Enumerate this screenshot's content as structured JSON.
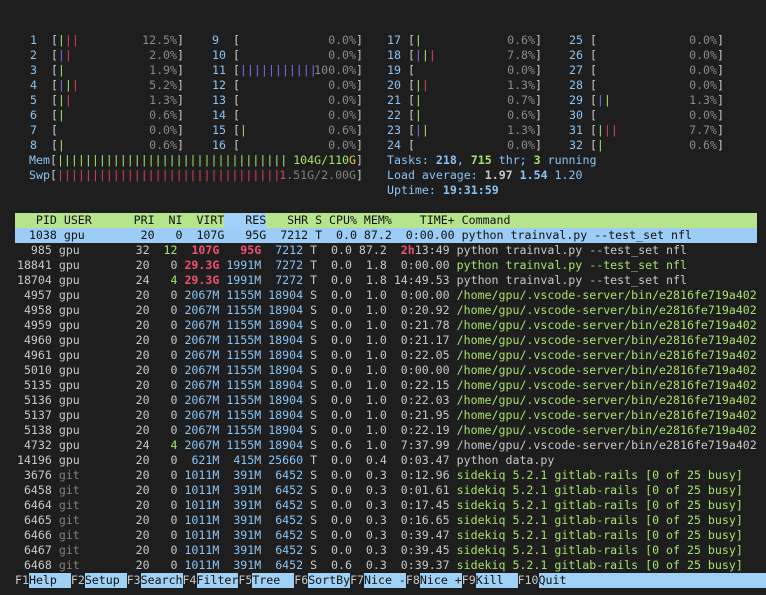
{
  "colors": {
    "label": "#89c4f4",
    "green": "#a6e26b",
    "red": "#d9425f",
    "purple": "#7d6ee6",
    "header_bg": "#b5e48c",
    "selected_bg": "#9ccdf6",
    "background": "#1e1e1e"
  },
  "cpus": [
    {
      "id": "1",
      "bars": [
        "g",
        "r",
        "r"
      ],
      "value": "12.5%"
    },
    {
      "id": "2",
      "bars": [
        "p",
        "r"
      ],
      "value": "2.0%"
    },
    {
      "id": "3",
      "bars": [
        "g"
      ],
      "value": "1.9%"
    },
    {
      "id": "4",
      "bars": [
        "p",
        "g",
        "r"
      ],
      "value": "5.2%"
    },
    {
      "id": "5",
      "bars": [
        "g",
        "r"
      ],
      "value": "1.3%"
    },
    {
      "id": "6",
      "bars": [
        "g"
      ],
      "value": "0.6%"
    },
    {
      "id": "7",
      "bars": [],
      "value": "0.0%"
    },
    {
      "id": "8",
      "bars": [
        "g"
      ],
      "value": "0.6%"
    },
    {
      "id": "9",
      "bars": [],
      "value": "0.0%"
    },
    {
      "id": "10",
      "bars": [],
      "value": "0.0%"
    },
    {
      "id": "11",
      "bars": [
        "p",
        "p",
        "p",
        "p",
        "p",
        "p",
        "p",
        "p",
        "p",
        "p",
        "p"
      ],
      "value": "100.0%",
      "value_color": "pv"
    },
    {
      "id": "12",
      "bars": [],
      "value": "0.0%"
    },
    {
      "id": "13",
      "bars": [],
      "value": "0.0%"
    },
    {
      "id": "14",
      "bars": [],
      "value": "0.0%"
    },
    {
      "id": "15",
      "bars": [
        "g"
      ],
      "value": "0.6%"
    },
    {
      "id": "16",
      "bars": [],
      "value": "0.0%"
    },
    {
      "id": "17",
      "bars": [
        "g"
      ],
      "value": "0.6%"
    },
    {
      "id": "18",
      "bars": [
        "p",
        "g",
        "r"
      ],
      "value": "7.8%"
    },
    {
      "id": "19",
      "bars": [],
      "value": "0.0%"
    },
    {
      "id": "20",
      "bars": [
        "g",
        "r"
      ],
      "value": "1.3%"
    },
    {
      "id": "21",
      "bars": [
        "g"
      ],
      "value": "0.7%"
    },
    {
      "id": "22",
      "bars": [
        "g"
      ],
      "value": "0.6%"
    },
    {
      "id": "23",
      "bars": [
        "p",
        "g"
      ],
      "value": "1.3%"
    },
    {
      "id": "24",
      "bars": [],
      "value": "0.0%"
    },
    {
      "id": "25",
      "bars": [],
      "value": "0.0%"
    },
    {
      "id": "26",
      "bars": [],
      "value": "0.0%"
    },
    {
      "id": "27",
      "bars": [],
      "value": "0.0%"
    },
    {
      "id": "28",
      "bars": [],
      "value": "0.0%"
    },
    {
      "id": "29",
      "bars": [
        "p",
        "g"
      ],
      "value": "1.3%"
    },
    {
      "id": "30",
      "bars": [],
      "value": "0.0%"
    },
    {
      "id": "31",
      "bars": [
        "g",
        "r",
        "r"
      ],
      "value": "7.7%"
    },
    {
      "id": "32",
      "bars": [
        "g"
      ],
      "value": "0.6%"
    }
  ],
  "mem": {
    "label": "Mem",
    "used": "104G/110",
    "unit": "G",
    "fill_fraction": 0.945
  },
  "swp": {
    "label": "Swp",
    "used_first": "1",
    "used_rest": ".51G/2.00G",
    "fill_fraction": 0.755
  },
  "tasks": {
    "label": "Tasks: ",
    "count": "218",
    "sep": ", ",
    "threads": "715",
    "thr_label": " thr; ",
    "running": "3",
    "running_label": " running"
  },
  "load": {
    "label": "Load average: ",
    "l1": "1.97",
    "l5": "1.54",
    "l15": "1.20"
  },
  "uptime": {
    "label": "Uptime: ",
    "value": "19:31:59"
  },
  "columns": {
    "pid": "PID",
    "user": "USER",
    "pri": "PRI",
    "ni": "NI",
    "virt": "VIRT",
    "res": "RES",
    "shr": "SHR",
    "s": "S",
    "cpu": "CPU%",
    "mem": "MEM%",
    "time": "TIME+",
    "cmd": "Command"
  },
  "processes": [
    {
      "pid": "1038",
      "user": "gpu",
      "pri": "20",
      "ni": "0",
      "virt": "107G",
      "res": "95G",
      "shr": "7212",
      "s": "T",
      "cpu": "0.0",
      "mem": "87.2",
      "time": "0:00.00",
      "cmd": "python trainval.py --test_set nfl",
      "selected": true
    },
    {
      "pid": "985",
      "user": "gpu",
      "pri": "32",
      "ni": "12",
      "virt": "107G",
      "res": "95G",
      "shr": "7212",
      "s": "T",
      "cpu": "0.0",
      "mem": "87.2",
      "time_h": "2h",
      "time": "13:49",
      "cmd": "python trainval.py --test_set nfl",
      "hl": {
        "ni": "g",
        "virt": "red",
        "res": "red",
        "shr": "b",
        "cmd": "w"
      }
    },
    {
      "pid": "18841",
      "user": "gpu",
      "pri": "20",
      "ni": "0",
      "virt": "29.3G",
      "res": "1991M",
      "shr": "7272",
      "s": "T",
      "cpu": "0.0",
      "mem": "1.8",
      "time": "0:00.00",
      "cmd": "python trainval.py --test_set nfl",
      "hl": {
        "virt": "red",
        "res": "b",
        "shr": "b",
        "cmd": "g"
      }
    },
    {
      "pid": "18704",
      "user": "gpu",
      "pri": "24",
      "ni": "4",
      "virt": "29.3G",
      "res": "1991M",
      "shr": "7272",
      "s": "T",
      "cpu": "0.0",
      "mem": "1.8",
      "time": "14:49.53",
      "cmd": "python trainval.py --test_set nfl",
      "hl": {
        "ni": "g",
        "virt": "red",
        "res": "b",
        "shr": "b",
        "cmd": "w"
      }
    },
    {
      "pid": "4957",
      "user": "gpu",
      "pri": "20",
      "ni": "0",
      "virt": "2067M",
      "res": "1155M",
      "shr": "18904",
      "s": "S",
      "cpu": "0.0",
      "mem": "1.0",
      "time": "0:00.00",
      "cmd": "/home/gpu/.vscode-server/bin/e2816fe719a402",
      "hl": {
        "virt": "b",
        "res": "b",
        "shr": "b",
        "cmd": "g"
      }
    },
    {
      "pid": "4958",
      "user": "gpu",
      "pri": "20",
      "ni": "0",
      "virt": "2067M",
      "res": "1155M",
      "shr": "18904",
      "s": "S",
      "cpu": "0.0",
      "mem": "1.0",
      "time": "0:20.92",
      "cmd": "/home/gpu/.vscode-server/bin/e2816fe719a402",
      "hl": {
        "virt": "b",
        "res": "b",
        "shr": "b",
        "cmd": "g"
      }
    },
    {
      "pid": "4959",
      "user": "gpu",
      "pri": "20",
      "ni": "0",
      "virt": "2067M",
      "res": "1155M",
      "shr": "18904",
      "s": "S",
      "cpu": "0.0",
      "mem": "1.0",
      "time": "0:21.78",
      "cmd": "/home/gpu/.vscode-server/bin/e2816fe719a402",
      "hl": {
        "virt": "b",
        "res": "b",
        "shr": "b",
        "cmd": "g"
      }
    },
    {
      "pid": "4960",
      "user": "gpu",
      "pri": "20",
      "ni": "0",
      "virt": "2067M",
      "res": "1155M",
      "shr": "18904",
      "s": "S",
      "cpu": "0.0",
      "mem": "1.0",
      "time": "0:21.17",
      "cmd": "/home/gpu/.vscode-server/bin/e2816fe719a402",
      "hl": {
        "virt": "b",
        "res": "b",
        "shr": "b",
        "cmd": "g"
      }
    },
    {
      "pid": "4961",
      "user": "gpu",
      "pri": "20",
      "ni": "0",
      "virt": "2067M",
      "res": "1155M",
      "shr": "18904",
      "s": "S",
      "cpu": "0.0",
      "mem": "1.0",
      "time": "0:22.05",
      "cmd": "/home/gpu/.vscode-server/bin/e2816fe719a402",
      "hl": {
        "virt": "b",
        "res": "b",
        "shr": "b",
        "cmd": "g"
      }
    },
    {
      "pid": "5010",
      "user": "gpu",
      "pri": "20",
      "ni": "0",
      "virt": "2067M",
      "res": "1155M",
      "shr": "18904",
      "s": "S",
      "cpu": "0.0",
      "mem": "1.0",
      "time": "0:00.00",
      "cmd": "/home/gpu/.vscode-server/bin/e2816fe719a402",
      "hl": {
        "virt": "b",
        "res": "b",
        "shr": "b",
        "cmd": "g"
      }
    },
    {
      "pid": "5135",
      "user": "gpu",
      "pri": "20",
      "ni": "0",
      "virt": "2067M",
      "res": "1155M",
      "shr": "18904",
      "s": "S",
      "cpu": "0.0",
      "mem": "1.0",
      "time": "0:22.15",
      "cmd": "/home/gpu/.vscode-server/bin/e2816fe719a402",
      "hl": {
        "virt": "b",
        "res": "b",
        "shr": "b",
        "cmd": "g"
      }
    },
    {
      "pid": "5136",
      "user": "gpu",
      "pri": "20",
      "ni": "0",
      "virt": "2067M",
      "res": "1155M",
      "shr": "18904",
      "s": "S",
      "cpu": "0.0",
      "mem": "1.0",
      "time": "0:22.03",
      "cmd": "/home/gpu/.vscode-server/bin/e2816fe719a402",
      "hl": {
        "virt": "b",
        "res": "b",
        "shr": "b",
        "cmd": "g"
      }
    },
    {
      "pid": "5137",
      "user": "gpu",
      "pri": "20",
      "ni": "0",
      "virt": "2067M",
      "res": "1155M",
      "shr": "18904",
      "s": "S",
      "cpu": "0.0",
      "mem": "1.0",
      "time": "0:21.95",
      "cmd": "/home/gpu/.vscode-server/bin/e2816fe719a402",
      "hl": {
        "virt": "b",
        "res": "b",
        "shr": "b",
        "cmd": "g"
      }
    },
    {
      "pid": "5138",
      "user": "gpu",
      "pri": "20",
      "ni": "0",
      "virt": "2067M",
      "res": "1155M",
      "shr": "18904",
      "s": "S",
      "cpu": "0.0",
      "mem": "1.0",
      "time": "0:22.19",
      "cmd": "/home/gpu/.vscode-server/bin/e2816fe719a402",
      "hl": {
        "virt": "b",
        "res": "b",
        "shr": "b",
        "cmd": "g"
      }
    },
    {
      "pid": "4732",
      "user": "gpu",
      "pri": "24",
      "ni": "4",
      "virt": "2067M",
      "res": "1155M",
      "shr": "18904",
      "s": "S",
      "cpu": "0.6",
      "mem": "1.0",
      "time": "7:37.99",
      "cmd": "/home/gpu/.vscode-server/bin/e2816fe719a402",
      "hl": {
        "ni": "g",
        "virt": "b",
        "res": "b",
        "shr": "b",
        "cmd": "w"
      }
    },
    {
      "pid": "14196",
      "user": "gpu",
      "pri": "20",
      "ni": "0",
      "virt": "621M",
      "res": "415M",
      "shr": "25660",
      "s": "T",
      "cpu": "0.0",
      "mem": "0.4",
      "time": "0:03.47",
      "cmd": "python data.py",
      "hl": {
        "virt": "b",
        "res": "b",
        "shr": "b",
        "cmd": "w"
      }
    },
    {
      "pid": "3676",
      "user": "git",
      "pri": "20",
      "ni": "0",
      "virt": "1011M",
      "res": "391M",
      "shr": "6452",
      "s": "S",
      "cpu": "0.0",
      "mem": "0.3",
      "time": "0:12.96",
      "cmd": "sidekiq 5.2.1 gitlab-rails [0 of 25 busy]",
      "hl": {
        "user": "dim",
        "virt": "b",
        "res": "b",
        "shr": "b",
        "cmd": "g"
      }
    },
    {
      "pid": "6458",
      "user": "git",
      "pri": "20",
      "ni": "0",
      "virt": "1011M",
      "res": "391M",
      "shr": "6452",
      "s": "S",
      "cpu": "0.0",
      "mem": "0.3",
      "time": "0:01.61",
      "cmd": "sidekiq 5.2.1 gitlab-rails [0 of 25 busy]",
      "hl": {
        "user": "dim",
        "virt": "b",
        "res": "b",
        "shr": "b",
        "cmd": "g"
      }
    },
    {
      "pid": "6464",
      "user": "git",
      "pri": "20",
      "ni": "0",
      "virt": "1011M",
      "res": "391M",
      "shr": "6452",
      "s": "S",
      "cpu": "0.0",
      "mem": "0.3",
      "time": "0:17.45",
      "cmd": "sidekiq 5.2.1 gitlab-rails [0 of 25 busy]",
      "hl": {
        "user": "dim",
        "virt": "b",
        "res": "b",
        "shr": "b",
        "cmd": "g"
      }
    },
    {
      "pid": "6465",
      "user": "git",
      "pri": "20",
      "ni": "0",
      "virt": "1011M",
      "res": "391M",
      "shr": "6452",
      "s": "S",
      "cpu": "0.0",
      "mem": "0.3",
      "time": "0:16.65",
      "cmd": "sidekiq 5.2.1 gitlab-rails [0 of 25 busy]",
      "hl": {
        "user": "dim",
        "virt": "b",
        "res": "b",
        "shr": "b",
        "cmd": "g"
      }
    },
    {
      "pid": "6466",
      "user": "git",
      "pri": "20",
      "ni": "0",
      "virt": "1011M",
      "res": "391M",
      "shr": "6452",
      "s": "S",
      "cpu": "0.0",
      "mem": "0.3",
      "time": "0:39.47",
      "cmd": "sidekiq 5.2.1 gitlab-rails [0 of 25 busy]",
      "hl": {
        "user": "dim",
        "virt": "b",
        "res": "b",
        "shr": "b",
        "cmd": "g"
      }
    },
    {
      "pid": "6467",
      "user": "git",
      "pri": "20",
      "ni": "0",
      "virt": "1011M",
      "res": "391M",
      "shr": "6452",
      "s": "S",
      "cpu": "0.0",
      "mem": "0.3",
      "time": "0:39.45",
      "cmd": "sidekiq 5.2.1 gitlab-rails [0 of 25 busy]",
      "hl": {
        "user": "dim",
        "virt": "b",
        "res": "b",
        "shr": "b",
        "cmd": "g"
      }
    },
    {
      "pid": "6468",
      "user": "git",
      "pri": "20",
      "ni": "0",
      "virt": "1011M",
      "res": "391M",
      "shr": "6452",
      "s": "S",
      "cpu": "0.6",
      "mem": "0.3",
      "time": "0:39.37",
      "cmd": "sidekiq 5.2.1 gitlab-rails [0 of 25 busy]",
      "hl": {
        "user": "dim",
        "virt": "b",
        "res": "b",
        "shr": "b",
        "cmd": "g"
      }
    }
  ],
  "footer": [
    {
      "key": "F1",
      "label": "Help"
    },
    {
      "key": "F2",
      "label": "Setup"
    },
    {
      "key": "F3",
      "label": "Search"
    },
    {
      "key": "F4",
      "label": "Filter"
    },
    {
      "key": "F5",
      "label": "Tree"
    },
    {
      "key": "F6",
      "label": "SortBy"
    },
    {
      "key": "F7",
      "label": "Nice -"
    },
    {
      "key": "F8",
      "label": "Nice +"
    },
    {
      "key": "F9",
      "label": "Kill"
    },
    {
      "key": "F10",
      "label": "Quit"
    }
  ]
}
